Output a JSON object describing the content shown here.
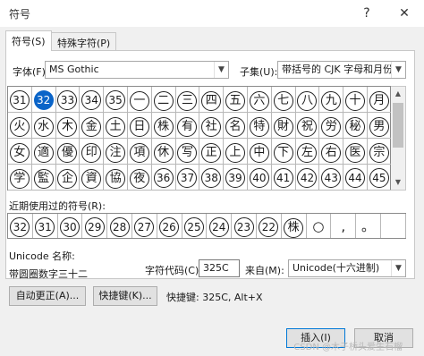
{
  "window": {
    "title": "符号",
    "help": "?",
    "close": "✕"
  },
  "tabs": [
    {
      "label": "符号(S)"
    },
    {
      "label": "特殊字符(P)"
    }
  ],
  "font": {
    "label": "字体(F):",
    "value": "MS Gothic"
  },
  "subset": {
    "label": "子集(U):",
    "value": "带括号的 CJK 字母和月份"
  },
  "grid": [
    [
      "31",
      "32",
      "33",
      "34",
      "35",
      "一",
      "二",
      "三",
      "四",
      "五",
      "六",
      "七",
      "八",
      "九",
      "十",
      "月"
    ],
    [
      "火",
      "水",
      "木",
      "金",
      "土",
      "日",
      "株",
      "有",
      "社",
      "名",
      "特",
      "財",
      "祝",
      "労",
      "秘",
      "男"
    ],
    [
      "女",
      "適",
      "優",
      "印",
      "注",
      "項",
      "休",
      "写",
      "正",
      "上",
      "中",
      "下",
      "左",
      "右",
      "医",
      "宗"
    ],
    [
      "学",
      "監",
      "企",
      "資",
      "協",
      "夜",
      "36",
      "37",
      "38",
      "39",
      "40",
      "41",
      "42",
      "43",
      "44",
      "45"
    ]
  ],
  "selected": {
    "row": 0,
    "col": 1
  },
  "recent": {
    "label": "近期使用过的符号(R):",
    "items": [
      "32",
      "31",
      "30",
      "29",
      "28",
      "27",
      "26",
      "25",
      "24",
      "23",
      "22",
      "株",
      "○",
      ",",
      "。",
      ""
    ]
  },
  "unicode_name": {
    "label": "Unicode 名称:",
    "value": "带圆圈数字三十二"
  },
  "char_code": {
    "label": "字符代码(C):",
    "value": "325C"
  },
  "from": {
    "label": "来自(M):",
    "value": "Unicode(十六进制)"
  },
  "buttons": {
    "autocorrect": "自动更正(A)...",
    "shortcut_key": "快捷键(K)...",
    "insert": "插入(I)",
    "cancel": "取消"
  },
  "shortcut_text": "快捷键: 325C, Alt+X",
  "watermark": "CSDN @木子桥头爱生石榴"
}
